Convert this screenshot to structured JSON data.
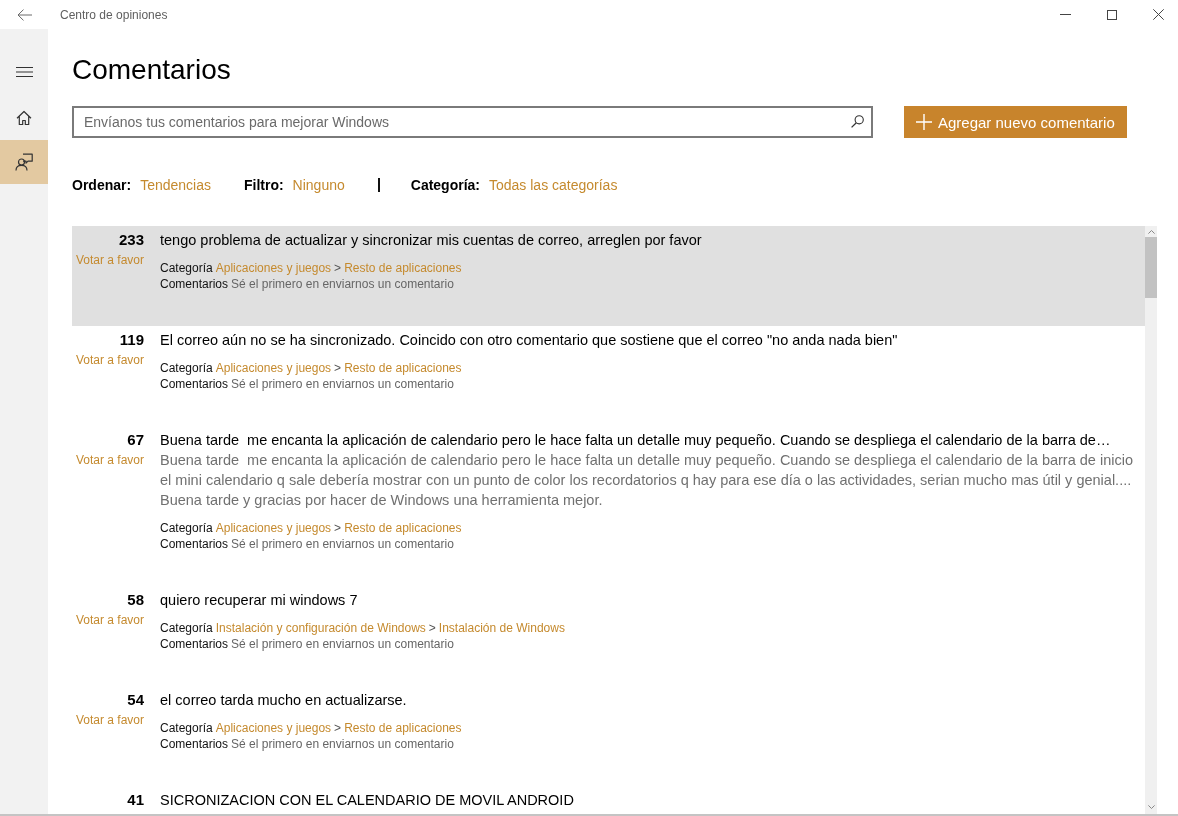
{
  "window": {
    "title": "Centro de opiniones"
  },
  "sidebar": {
    "items": [
      {
        "kind": "home",
        "selected": false
      },
      {
        "kind": "feedback",
        "selected": true
      }
    ]
  },
  "header": {
    "heading": "Comentarios",
    "search": {
      "placeholder": "Envíanos tus comentarios para mejorar Windows"
    },
    "add_button": {
      "label": "Agregar nuevo comentario"
    }
  },
  "filters": {
    "sort": {
      "label": "Ordenar:",
      "value": "Tendencias"
    },
    "filter": {
      "label": "Filtro:",
      "value": "Ninguno"
    },
    "category": {
      "label": "Categoría:",
      "value": "Todas las categorías"
    }
  },
  "feedback_list": {
    "items": [
      {
        "votes": "233",
        "vote_label": "Votar a favor",
        "title": "tengo problema de actualizar y sincronizar mis cuentas de correo, arreglen por favor",
        "category": {
          "label": "Categoría",
          "main": "Aplicaciones y juegos",
          "separator": ">",
          "sub": "Resto de aplicaciones"
        },
        "comments": {
          "label": "Comentarios",
          "hint": "Sé el primero en enviarnos un comentario"
        },
        "selected": true
      },
      {
        "votes": "119",
        "vote_label": "Votar a favor",
        "title": "El correo aún no se ha sincronizado. Coincido con otro comentario que sostiene que el correo \"no anda nada bien\"",
        "category": {
          "label": "Categoría",
          "main": "Aplicaciones y juegos",
          "separator": ">",
          "sub": "Resto de aplicaciones"
        },
        "comments": {
          "label": "Comentarios",
          "hint": "Sé el primero en enviarnos un comentario"
        },
        "selected": false
      },
      {
        "votes": "67",
        "vote_label": "Votar a favor",
        "title": "Buena tarde  me encanta la aplicación de calendario pero le hace falta un detalle muy pequeño. Cuando se despliega el calendario de la barra de…",
        "description": "Buena tarde  me encanta la aplicación de calendario pero le hace falta un detalle muy pequeño. Cuando se despliega el calendario de la barra de inicio el mini calendario q sale debería mostrar con un punto de color los recordatorios q hay para ese día o las actividades, serian mucho mas útil y genial....  Buena tarde y gracias por hacer de Windows una herramienta mejor.",
        "category": {
          "label": "Categoría",
          "main": "Aplicaciones y juegos",
          "separator": ">",
          "sub": "Resto de aplicaciones"
        },
        "comments": {
          "label": "Comentarios",
          "hint": "Sé el primero en enviarnos un comentario"
        },
        "selected": false
      },
      {
        "votes": "58",
        "vote_label": "Votar a favor",
        "title": "quiero recuperar mi windows 7",
        "category": {
          "label": "Categoría",
          "main": "Instalación y configuración de Windows",
          "separator": ">",
          "sub": "Instalación de Windows"
        },
        "comments": {
          "label": "Comentarios",
          "hint": "Sé el primero en enviarnos un comentario"
        },
        "selected": false
      },
      {
        "votes": "54",
        "vote_label": "Votar a favor",
        "title": "el correo tarda mucho en actualizarse.",
        "category": {
          "label": "Categoría",
          "main": "Aplicaciones y juegos",
          "separator": ">",
          "sub": "Resto de aplicaciones"
        },
        "comments": {
          "label": "Comentarios",
          "hint": "Sé el primero en enviarnos un comentario"
        },
        "selected": false
      },
      {
        "votes": "41",
        "title": "SICRONIZACION CON EL CALENDARIO DE MOVIL ANDROID",
        "selected": false
      }
    ]
  }
}
